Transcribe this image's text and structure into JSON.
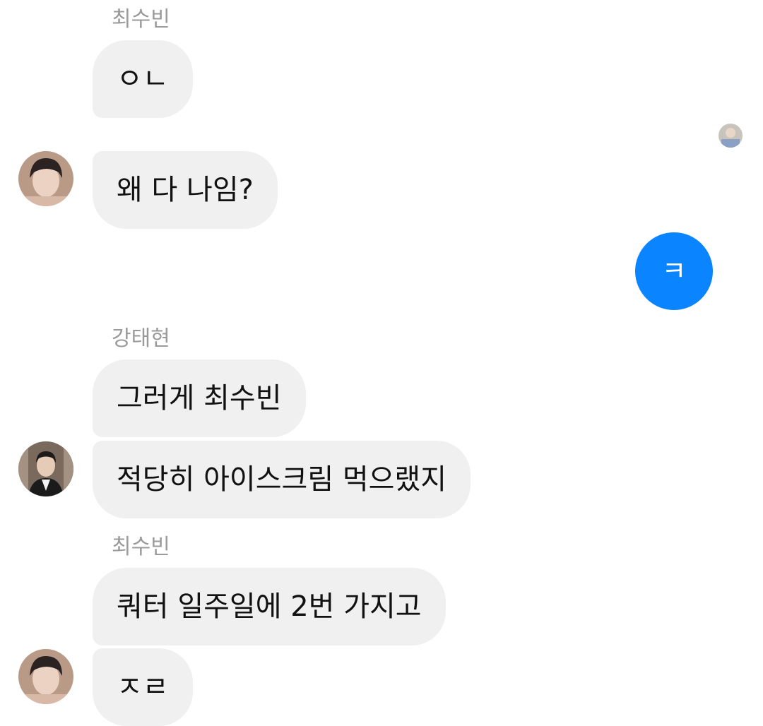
{
  "messages": [
    {
      "sender": "최수빈",
      "text": "ㅇㄴ"
    },
    {
      "text": "왜 다 나임?"
    },
    {
      "text": "ㅋ",
      "outgoing": true
    },
    {
      "sender": "강태현",
      "text": "그러게 최수빈"
    },
    {
      "text": "적당히 아이스크림 먹으랬지"
    },
    {
      "sender": "최수빈",
      "text": "쿼터 일주일에 2번 가지고"
    },
    {
      "text": "ㅈㄹ"
    }
  ],
  "colors": {
    "incoming_bubble": "#f0f0f0",
    "outgoing_bubble": "#0a84ff",
    "sender_label": "#9a9a9a"
  }
}
